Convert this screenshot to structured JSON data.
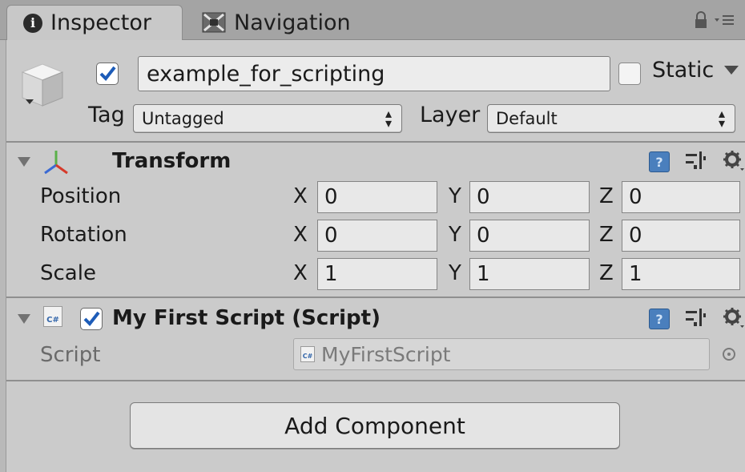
{
  "tabs": [
    {
      "label": "Inspector",
      "icon": "info-icon"
    },
    {
      "label": "Navigation",
      "icon": "navigation-icon"
    }
  ],
  "tabbar_icons": [
    "lock-icon",
    "menu-icon"
  ],
  "gameobject": {
    "icon": "gameobject-cube-icon",
    "active_checked": true,
    "name": "example_for_scripting",
    "static_label": "Static",
    "static_checked": false,
    "tag_label": "Tag",
    "tag_value": "Untagged",
    "layer_label": "Layer",
    "layer_value": "Default"
  },
  "transform": {
    "title": "Transform",
    "icon": "transform-axes-icon",
    "rows": [
      {
        "label": "Position",
        "x": "0",
        "y": "0",
        "z": "0"
      },
      {
        "label": "Rotation",
        "x": "0",
        "y": "0",
        "z": "0"
      },
      {
        "label": "Scale",
        "x": "1",
        "y": "1",
        "z": "1"
      }
    ],
    "axis_labels": {
      "x": "X",
      "y": "Y",
      "z": "Z"
    }
  },
  "script_component": {
    "icon": "csharp-file-icon",
    "icon_text": "C#",
    "enabled_checked": true,
    "title": "My First Script (Script)",
    "script_label": "Script",
    "script_value": "MyFirstScript"
  },
  "component_header_icons": [
    "help-book-icon",
    "preset-icon",
    "gear-icon"
  ],
  "add_component_label": "Add Component",
  "colors": {
    "panel_bg": "#cbcbcb",
    "tab_bar_bg": "#a4a4a4",
    "checkbox_check": "#1d5cb8",
    "help_icon": "#4a7fbd"
  }
}
